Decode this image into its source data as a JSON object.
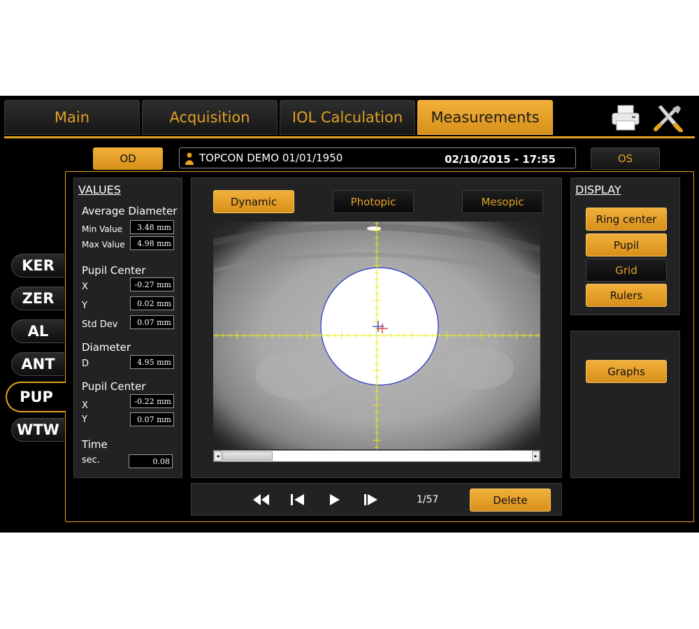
{
  "tabs": [
    {
      "label": "Main",
      "active": false
    },
    {
      "label": "Acquisition",
      "active": false
    },
    {
      "label": "IOL Calculation",
      "active": false
    },
    {
      "label": "Measurements",
      "active": true
    }
  ],
  "toolbar": {
    "print_icon": "printer-icon",
    "tools_icon": "tools-icon"
  },
  "eyes": {
    "od_label": "OD",
    "os_label": "OS",
    "selected": "OD"
  },
  "patient": {
    "name": "TOPCON DEMO 01/01/1950",
    "date": "02/10/2015 - 17:55"
  },
  "side_tabs": [
    "KER",
    "ZER",
    "AL",
    "ANT",
    "PUP",
    "WTW"
  ],
  "side_tab_active": "PUP",
  "values": {
    "heading": "VALUES",
    "avg_diameter": {
      "title": "Average Diameter",
      "min_label": "Min Value",
      "min_value": "3.48 mm",
      "max_label": "Max Value",
      "max_value": "4.98 mm"
    },
    "pupil_center": {
      "title": "Pupil Center",
      "x_label": "X",
      "x_value": "-0.27 mm",
      "y_label": "Y",
      "y_value": "0.02 mm",
      "std_label": "Std Dev",
      "std_value": "0.07 mm"
    },
    "diameter": {
      "title": "Diameter",
      "d_label": "D",
      "d_value": "4.95 mm"
    },
    "pupil_center2": {
      "title": "Pupil Center",
      "x_label": "X",
      "x_value": "-0.22 mm",
      "y_label": "Y",
      "y_value": "0.07 mm"
    },
    "time": {
      "title": "Time",
      "sec_label": "sec.",
      "sec_value": "0.08"
    }
  },
  "modes": [
    {
      "label": "Dynamic",
      "active": true
    },
    {
      "label": "Photopic",
      "active": false
    },
    {
      "label": "Mesopic",
      "active": false
    }
  ],
  "display": {
    "heading": "DISPLAY",
    "buttons": [
      {
        "label": "Ring center",
        "active": true
      },
      {
        "label": "Pupil",
        "active": true
      },
      {
        "label": "Grid",
        "active": false
      },
      {
        "label": "Rulers",
        "active": true
      }
    ]
  },
  "graphs_label": "Graphs",
  "playback": {
    "counter": "1/57",
    "delete_label": "Delete"
  },
  "colors": {
    "accent": "#e6a320",
    "ruler": "#e8e820",
    "pupil_outline": "#2233cc"
  }
}
